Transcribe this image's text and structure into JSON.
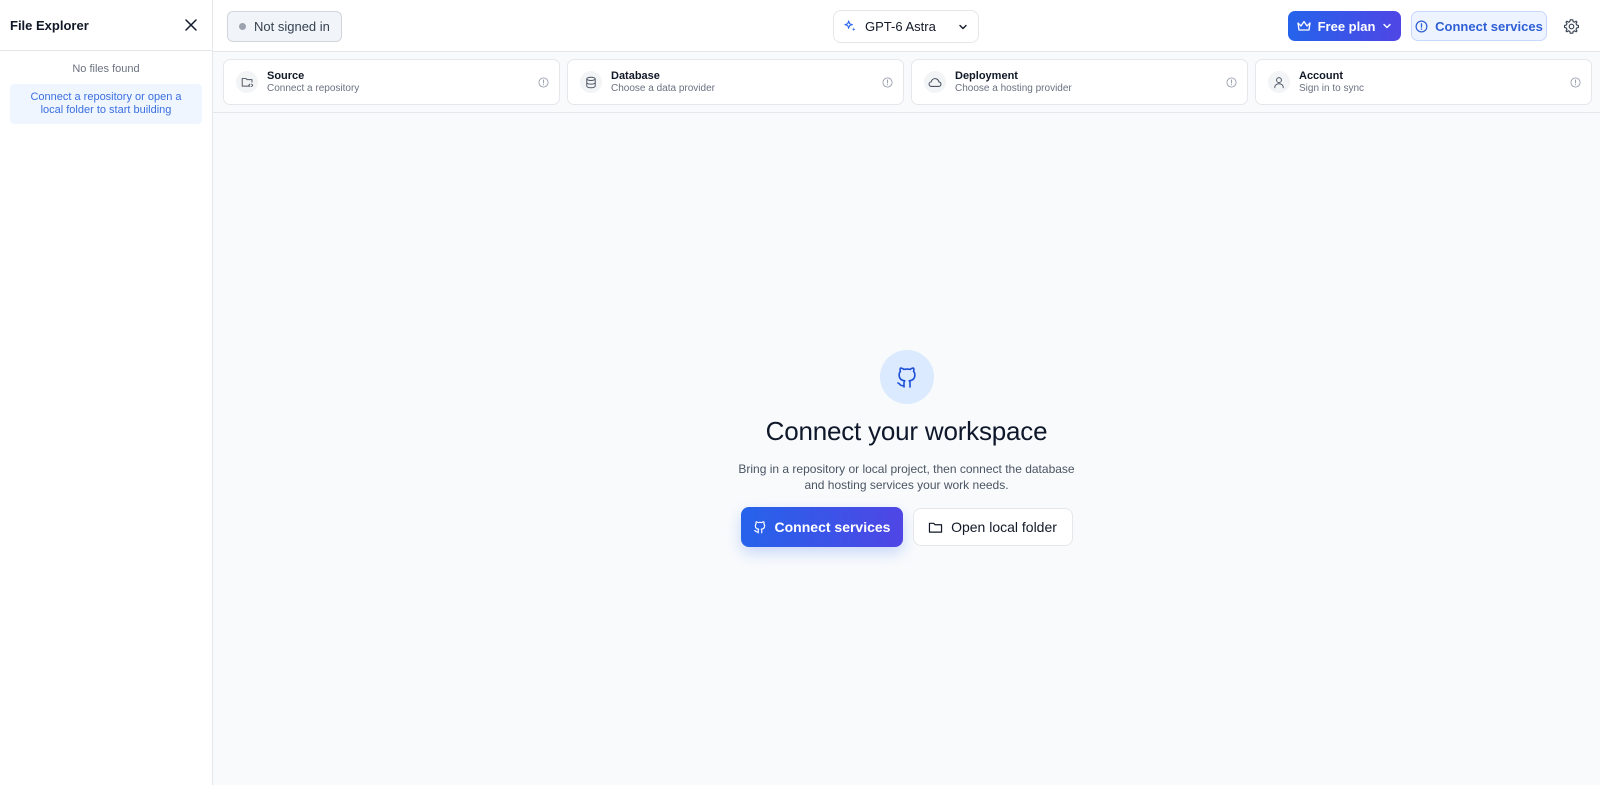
{
  "sidebar": {
    "title": "File Explorer",
    "close_icon": "close-icon",
    "empty_text": "No files found",
    "hint_text": "Connect a repository or open a local folder to start building"
  },
  "topbar": {
    "status_label": "Not signed in",
    "status_dot_color": "#9ca3af",
    "model_label": "GPT-6 Astra",
    "model_icon": "sparkle-icon",
    "plan_label": "Free plan",
    "plan_icon": "crown-icon",
    "connect_label": "Connect services",
    "connect_icon": "info-circle-icon",
    "settings_icon": "gear-icon"
  },
  "cards": [
    {
      "title": "Source",
      "subtitle": "Connect a repository",
      "icon": "folder-code-icon"
    },
    {
      "title": "Database",
      "subtitle": "Choose a data provider",
      "icon": "database-icon"
    },
    {
      "title": "Deployment",
      "subtitle": "Choose a hosting provider",
      "icon": "cloud-icon"
    },
    {
      "title": "Account",
      "subtitle": "Sign in to sync",
      "icon": "user-icon"
    }
  ],
  "empty_state": {
    "icon": "github-icon",
    "title": "Connect your workspace",
    "description": "Bring in a repository or local project, then connect the database and hosting services your work needs.",
    "primary_label": "Connect services",
    "secondary_label": "Open local folder"
  },
  "colors": {
    "accent": "#2563eb",
    "accent_end": "#4f46e5",
    "soft_blue": "#eff6ff"
  }
}
